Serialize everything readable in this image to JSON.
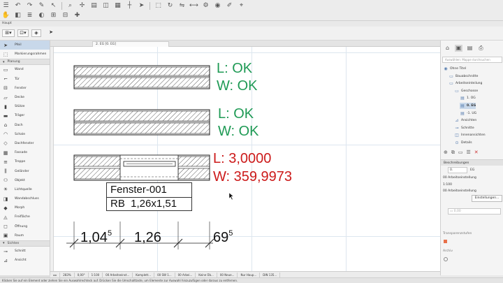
{
  "toolbar": {
    "icons": [
      "menu-icon",
      "undo-icon",
      "redo-icon",
      "pencil-icon",
      "pointer-icon",
      "zoom-icon",
      "snap-icon",
      "layer-icon",
      "view-icon",
      "grid-icon",
      "guide-icon",
      "arrow-icon",
      "marquee-icon",
      "rotate-icon",
      "mirror-icon",
      "measure-icon",
      "settings-icon",
      "eye-icon",
      "brush-icon",
      "cursor-icon",
      "hand-icon",
      "trace-icon",
      "list-icon",
      "render-icon",
      "grid2-icon",
      "table-icon",
      "plus-icon"
    ]
  },
  "toolbox": {
    "title": "Haupt",
    "items_pre": [
      {
        "label": "Pfeil",
        "icon": "arrow-icon",
        "selected": true
      },
      {
        "label": "Markierungsrahmen",
        "icon": "marquee-icon",
        "selected": false
      }
    ],
    "sections": [
      {
        "title": "Planung",
        "items": [
          {
            "label": "Wand",
            "icon": "wall-icon"
          },
          {
            "label": "Tür",
            "icon": "door-icon"
          },
          {
            "label": "Fenster",
            "icon": "window-icon"
          },
          {
            "label": "Decke",
            "icon": "slab-icon"
          },
          {
            "label": "Stütze",
            "icon": "column-icon"
          },
          {
            "label": "Träger",
            "icon": "beam-icon"
          },
          {
            "label": "Dach",
            "icon": "roof-icon"
          },
          {
            "label": "Schale",
            "icon": "shell-icon"
          },
          {
            "label": "Dachfenster",
            "icon": "skylight-icon"
          },
          {
            "label": "Fassade",
            "icon": "curtain-wall-icon"
          },
          {
            "label": "Treppe",
            "icon": "stair-icon"
          },
          {
            "label": "Geländer",
            "icon": "railing-icon"
          },
          {
            "label": "Objekt",
            "icon": "object-icon"
          },
          {
            "label": "Lichtquelle",
            "icon": "lamp-icon"
          },
          {
            "label": "Wandabschluss",
            "icon": "wall-end-icon"
          },
          {
            "label": "Morph",
            "icon": "morph-icon"
          },
          {
            "label": "Freifläche",
            "icon": "mesh-icon"
          },
          {
            "label": "Öffnung",
            "icon": "opening-icon"
          },
          {
            "label": "Raum",
            "icon": "zone-icon"
          }
        ]
      },
      {
        "title": "Sichten",
        "items": [
          {
            "label": "Schnitt",
            "icon": "section-icon"
          },
          {
            "label": "Ansicht",
            "icon": "elevation-icon"
          }
        ]
      }
    ]
  },
  "tabs": [
    {
      "label": "2. EG [0. EG]"
    }
  ],
  "plan": {
    "status_1": {
      "length": "L: OK",
      "width": "W: OK"
    },
    "status_2": {
      "length": "L: OK",
      "width": "W: OK"
    },
    "status_3": {
      "length": "L: 3,0000",
      "width": "W: 359,9973"
    },
    "window_label": {
      "name": "Fenster-001",
      "rb": "RB  1,26x1,51"
    },
    "dimensions": [
      {
        "value": "1,04",
        "superscript": "5"
      },
      {
        "value": "1,26",
        "superscript": ""
      },
      {
        "value": "69",
        "superscript": "5"
      }
    ],
    "colors": {
      "ok": "#1f9a55",
      "error": "#cc1a1a"
    }
  },
  "navigator": {
    "search_placeholder": "Auswählen: Mappe durchsuchen",
    "tree": [
      {
        "label": "Ohne Titel",
        "icon": "project-icon",
        "level": 0,
        "selected": false
      },
      {
        "label": "Bauabschnitte",
        "icon": "folder-icon",
        "level": 1,
        "selected": false
      },
      {
        "label": "Arbeitseinteilung",
        "icon": "folder-icon",
        "level": 1,
        "selected": false
      },
      {
        "label": "Geschosse",
        "icon": "folder-icon",
        "level": 2,
        "selected": false
      },
      {
        "label": "1. OG",
        "icon": "story-icon",
        "level": 3,
        "selected": false
      },
      {
        "label": "0. EG",
        "icon": "story-icon",
        "level": 3,
        "selected": true
      },
      {
        "label": "-1. UG",
        "icon": "story-icon",
        "level": 3,
        "selected": false
      },
      {
        "label": "Ansichten",
        "icon": "elevation-icon",
        "level": 2,
        "selected": false
      },
      {
        "label": "Schnitte",
        "icon": "section-icon",
        "level": 2,
        "selected": false
      },
      {
        "label": "Innenansichten",
        "icon": "interior-icon",
        "level": 2,
        "selected": false
      },
      {
        "label": "Details",
        "icon": "detail-icon",
        "level": 2,
        "selected": false
      }
    ],
    "properties": {
      "header": "Beschreibungen",
      "id_value": "0.",
      "id_suffix": "EG",
      "row_1": "00 Arbeitseinstellung",
      "scale": "1:100",
      "row_2": "00 Arbeitseinstellung",
      "settings_button": "Einstellungen..."
    },
    "sections": [
      {
        "label": "Transparenzstufen"
      },
      {
        "label": "Archiv"
      }
    ]
  },
  "statusbar": {
    "items": [
      "◂ ▸",
      "283%",
      "0,00°",
      "1:100",
      "00 Arbeitseinst...",
      "Komplett...",
      "00 SW 1...",
      "00 Arbei...",
      "Keine Üb...",
      "00 Neue...",
      "Nur Haup...",
      "DIN 135..."
    ]
  },
  "hint": "Klicken Sie auf ein Element oder ziehen Sie ein Auswahlrechteck auf. Drücken Sie die Umschalttaste, um Elemente zur Auswahl hinzuzufügen oder daraus zu entfernen."
}
